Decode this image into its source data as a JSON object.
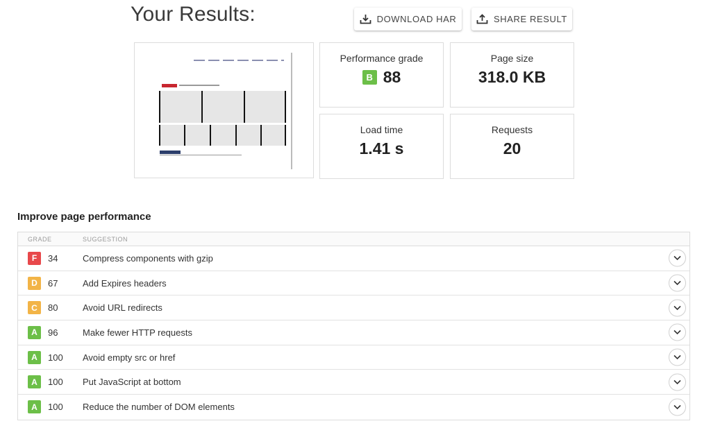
{
  "page": {
    "title": "Your Results:"
  },
  "actions": {
    "download_label": "DOWNLOAD HAR",
    "download_icon": "download-icon",
    "share_label": "SHARE RESULT",
    "share_icon": "share-icon"
  },
  "stats": {
    "performance": {
      "label": "Performance grade",
      "grade": "B",
      "grade_color": "#6cbf48",
      "value": "88"
    },
    "page_size": {
      "label": "Page size",
      "value": "318.0 KB"
    },
    "load_time": {
      "label": "Load time",
      "value": "1.41 s"
    },
    "requests": {
      "label": "Requests",
      "value": "20"
    }
  },
  "improve": {
    "title": "Improve page performance",
    "columns": {
      "grade": "GRADE",
      "suggestion": "SUGGESTION"
    },
    "rows": [
      {
        "grade": "F",
        "color": "#e8484b",
        "score": "34",
        "suggestion": "Compress components with gzip"
      },
      {
        "grade": "D",
        "color": "#f2b447",
        "score": "67",
        "suggestion": "Add Expires headers"
      },
      {
        "grade": "C",
        "color": "#f2b447",
        "score": "80",
        "suggestion": "Avoid URL redirects"
      },
      {
        "grade": "A",
        "color": "#6cbf48",
        "score": "96",
        "suggestion": "Make fewer HTTP requests"
      },
      {
        "grade": "A",
        "color": "#6cbf48",
        "score": "100",
        "suggestion": "Avoid empty src or href"
      },
      {
        "grade": "A",
        "color": "#6cbf48",
        "score": "100",
        "suggestion": "Put JavaScript at bottom"
      },
      {
        "grade": "A",
        "color": "#6cbf48",
        "score": "100",
        "suggestion": "Reduce the number of DOM elements"
      }
    ],
    "expand_icon": "chevron-down-icon"
  }
}
